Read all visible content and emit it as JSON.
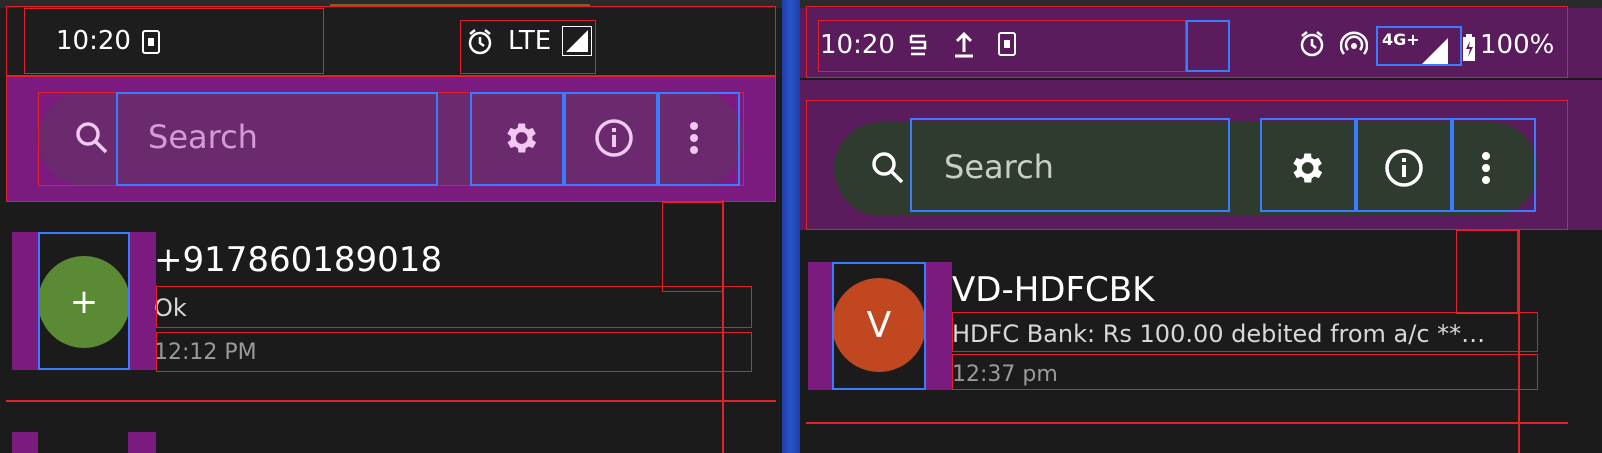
{
  "left_panel": {
    "status": {
      "time": "10:20",
      "network": "LTE"
    },
    "search": {
      "placeholder": "Search"
    },
    "conversation": {
      "avatar_glyph": "+",
      "avatar_color": "#5b8a35",
      "name": "+917860189018",
      "snippet": "Ok",
      "time": "12:12 PM"
    }
  },
  "right_panel": {
    "status": {
      "time": "10:20",
      "network": "4G+",
      "battery": "100%"
    },
    "search": {
      "placeholder": "Search"
    },
    "conversation": {
      "avatar_glyph": "V",
      "avatar_color": "#c0471f",
      "name": "VD-HDFCBK",
      "snippet": "HDFC Bank: Rs 100.00 debited from a/c **…",
      "time": "12:37 pm"
    }
  },
  "icons": {
    "search": "search-icon",
    "settings": "gear-icon",
    "info": "info-icon",
    "more": "more-vert-icon",
    "alarm": "alarm-icon",
    "signal": "signal-icon",
    "sim": "sim-card-icon",
    "upload": "upload-icon",
    "hotspot": "hotspot-icon",
    "battery": "battery-icon",
    "app": "app-notification-icon"
  },
  "colors": {
    "overlay_purple": "#7b1b7f",
    "highlight_red": "#e0202a",
    "highlight_blue": "#3b7cff"
  }
}
